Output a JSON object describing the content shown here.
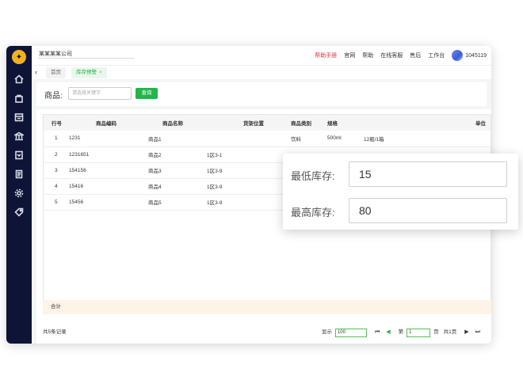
{
  "header": {
    "company": "某某某某公司",
    "nav": [
      "帮助手册",
      "官网",
      "帮助",
      "在线客服",
      "售后",
      "工作台"
    ],
    "user_id": "1045119"
  },
  "tabs": [
    {
      "label": "首页"
    },
    {
      "label": "库存预警",
      "close": "×"
    }
  ],
  "search": {
    "label": "商品:",
    "placeholder": "请选择关键字",
    "button": "查询"
  },
  "table": {
    "headers": [
      "行号",
      "商品编码",
      "商品名称",
      "货架位置",
      "商品类别",
      "规格",
      "单位"
    ],
    "rows": [
      [
        "1",
        "1231",
        "商品1",
        "",
        "饮料",
        "500ml",
        "12瓶/1箱"
      ],
      [
        "2",
        "1231651",
        "商品2",
        "1区3-1",
        "",
        "",
        ""
      ],
      [
        "3",
        "154156",
        "商品3",
        "1区3-9",
        "",
        "",
        ""
      ],
      [
        "4",
        "15416",
        "商品4",
        "1区3-9",
        "",
        "",
        ""
      ],
      [
        "5",
        "15456",
        "商品5",
        "1区3-9",
        "",
        "",
        ""
      ]
    ],
    "total_label": "合计"
  },
  "footer": {
    "record_count": "共5条记录",
    "show_label": "显示",
    "page_size": "100",
    "page_prefix": "第",
    "page_number": "1",
    "page_suffix": "页",
    "page_total": "共1页"
  },
  "popup": {
    "min_label": "最低库存:",
    "min_value": "15",
    "max_label": "最高库存:",
    "max_value": "80"
  },
  "colors": {
    "sidebar": "#0d1436",
    "accent": "#25b34b",
    "help_red": "#e0322b"
  }
}
